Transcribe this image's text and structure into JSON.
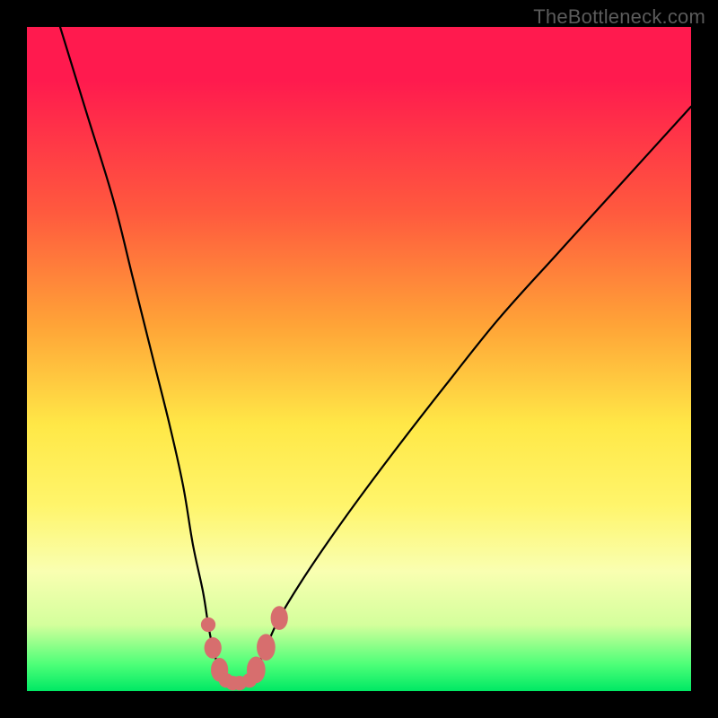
{
  "watermark": "TheBottleneck.com",
  "chart_data": {
    "type": "line",
    "title": "",
    "xlabel": "",
    "ylabel": "",
    "xlim": [
      0,
      100
    ],
    "ylim": [
      0,
      100
    ],
    "series": [
      {
        "name": "bottleneck-curve",
        "x": [
          5,
          9,
          13,
          16,
          19,
          21.5,
          23.5,
          25,
          26.5,
          27.3,
          28,
          29,
          30,
          31,
          32,
          33.5,
          34.5,
          36,
          38,
          41,
          45,
          50,
          56,
          63,
          71,
          80,
          90,
          100
        ],
        "y": [
          100,
          87,
          74,
          62,
          50,
          40,
          31,
          22,
          15,
          10,
          6.5,
          3.2,
          1.6,
          1.2,
          1.2,
          1.6,
          3.2,
          6.6,
          11,
          16,
          22,
          29,
          37,
          46,
          56,
          66,
          77,
          88
        ]
      }
    ],
    "markers": [
      {
        "name": "marker-left-upper",
        "x": 27.3,
        "y": 10,
        "rx": 1.1,
        "ry": 1.1
      },
      {
        "name": "marker-left-mid",
        "x": 28.0,
        "y": 6.5,
        "rx": 1.3,
        "ry": 1.6
      },
      {
        "name": "marker-left-low",
        "x": 29.0,
        "y": 3.2,
        "rx": 1.3,
        "ry": 1.8
      },
      {
        "name": "marker-bottom-1",
        "x": 30.0,
        "y": 1.6,
        "rx": 1.1,
        "ry": 1.1
      },
      {
        "name": "marker-bottom-2",
        "x": 31.0,
        "y": 1.2,
        "rx": 1.1,
        "ry": 1.1
      },
      {
        "name": "marker-bottom-3",
        "x": 32.0,
        "y": 1.2,
        "rx": 1.1,
        "ry": 1.1
      },
      {
        "name": "marker-bottom-4",
        "x": 33.5,
        "y": 1.6,
        "rx": 1.1,
        "ry": 1.1
      },
      {
        "name": "marker-right-low",
        "x": 34.5,
        "y": 3.2,
        "rx": 1.4,
        "ry": 2.0
      },
      {
        "name": "marker-right-mid",
        "x": 36.0,
        "y": 6.6,
        "rx": 1.4,
        "ry": 2.0
      },
      {
        "name": "marker-right-upper",
        "x": 38.0,
        "y": 11,
        "rx": 1.3,
        "ry": 1.8
      }
    ],
    "gradient_stops": [
      {
        "pos": 0,
        "color": "#ff1a4e"
      },
      {
        "pos": 28,
        "color": "#ff5a3e"
      },
      {
        "pos": 45,
        "color": "#ffa437"
      },
      {
        "pos": 60,
        "color": "#ffe847"
      },
      {
        "pos": 82,
        "color": "#f9ffb1"
      },
      {
        "pos": 96,
        "color": "#4dff78"
      },
      {
        "pos": 100,
        "color": "#00e864"
      }
    ]
  }
}
